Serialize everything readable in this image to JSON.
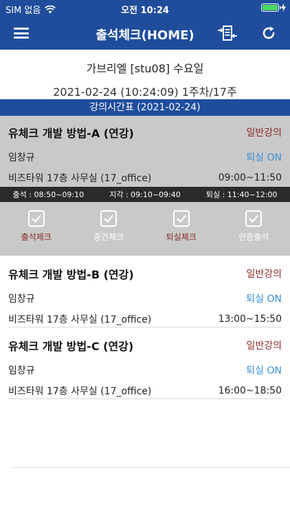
{
  "status_bar": {
    "carrier": "SIM 없음",
    "time": "오전 10:24",
    "battery_color": "#4cd964"
  },
  "navbar": {
    "title": "출석체크(HOME)"
  },
  "student": {
    "line1": "가브리엘 [stu08] 수요일",
    "line2": "2021-02-24 (10:24:09) 1주차/17주"
  },
  "timetable": {
    "label": "강의시간표 (2021-02-24)"
  },
  "courses": [
    {
      "name": "유체크 개발 방법-A (연강)",
      "type": "일반강의",
      "teacher": "임창규",
      "leave_status": "퇴실 ON",
      "room": "비즈타워 17층 사무실 (17_office)",
      "time": "09:00~11:50"
    },
    {
      "name": "유체크 개발 방법-B (연강)",
      "type": "일반강의",
      "teacher": "임창규",
      "leave_status": "퇴실 ON",
      "room": "비즈타워 17층 사무실 (17_office)",
      "time": "13:00~15:50"
    },
    {
      "name": "유체크 개발 방법-C (연강)",
      "type": "일반강의",
      "teacher": "임창규",
      "leave_status": "퇴실 ON",
      "room": "비즈타워 17층 사무실 (17_office)",
      "time": "16:00~18:50"
    }
  ],
  "check_times": {
    "attend": "출석 :   08:50~09:10",
    "late": "지각 :   09:10~09:40",
    "leave": "퇴실 :   11:40~12:00"
  },
  "actions": [
    "출석체크",
    "중간체크",
    "퇴실체크",
    "인증출석"
  ]
}
